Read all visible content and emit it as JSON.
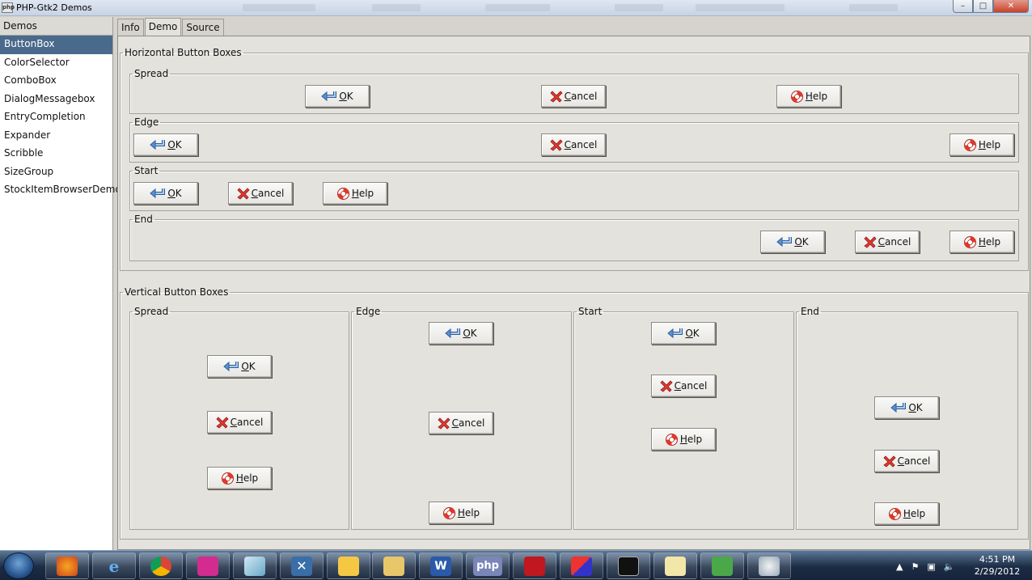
{
  "window": {
    "title": "PHP-Gtk2 Demos",
    "app_icon_text": "php",
    "controls": {
      "minimize": "–",
      "maximize": "□",
      "close": "✕"
    }
  },
  "sidebar": {
    "header": "Demos",
    "items": [
      "ButtonBox",
      "ColorSelector",
      "ComboBox",
      "DialogMessagebox",
      "EntryCompletion",
      "Expander",
      "Scribble",
      "SizeGroup",
      "StockItemBrowserDemo"
    ],
    "selected": "ButtonBox"
  },
  "tabs": [
    "Info",
    "Demo",
    "Source"
  ],
  "active_tab": "Demo",
  "buttons": {
    "ok": "OK",
    "cancel": "Cancel",
    "help": "Help"
  },
  "horizontal": {
    "title": "Horizontal Button Boxes",
    "spread": "Spread",
    "edge": "Edge",
    "start": "Start",
    "end": "End"
  },
  "vertical": {
    "title": "Vertical Button Boxes",
    "spread": "Spread",
    "edge": "Edge",
    "start": "Start",
    "end": "End"
  },
  "taskbar": {
    "apps": [
      "firefox",
      "internet-explorer",
      "chrome",
      "app-pink",
      "app-tablet",
      "app-x",
      "outlook",
      "file-explorer",
      "word",
      "php",
      "flash",
      "app-flag",
      "terminal",
      "notepad",
      "network",
      "paint"
    ],
    "app_labels": {
      "php": "php"
    },
    "clock_time": "4:51 PM",
    "clock_date": "2/29/2012"
  },
  "colors": {
    "selection": "#4a6a8c",
    "window_bg": "#e4e2dd",
    "taskbar": "#1c2c44"
  }
}
